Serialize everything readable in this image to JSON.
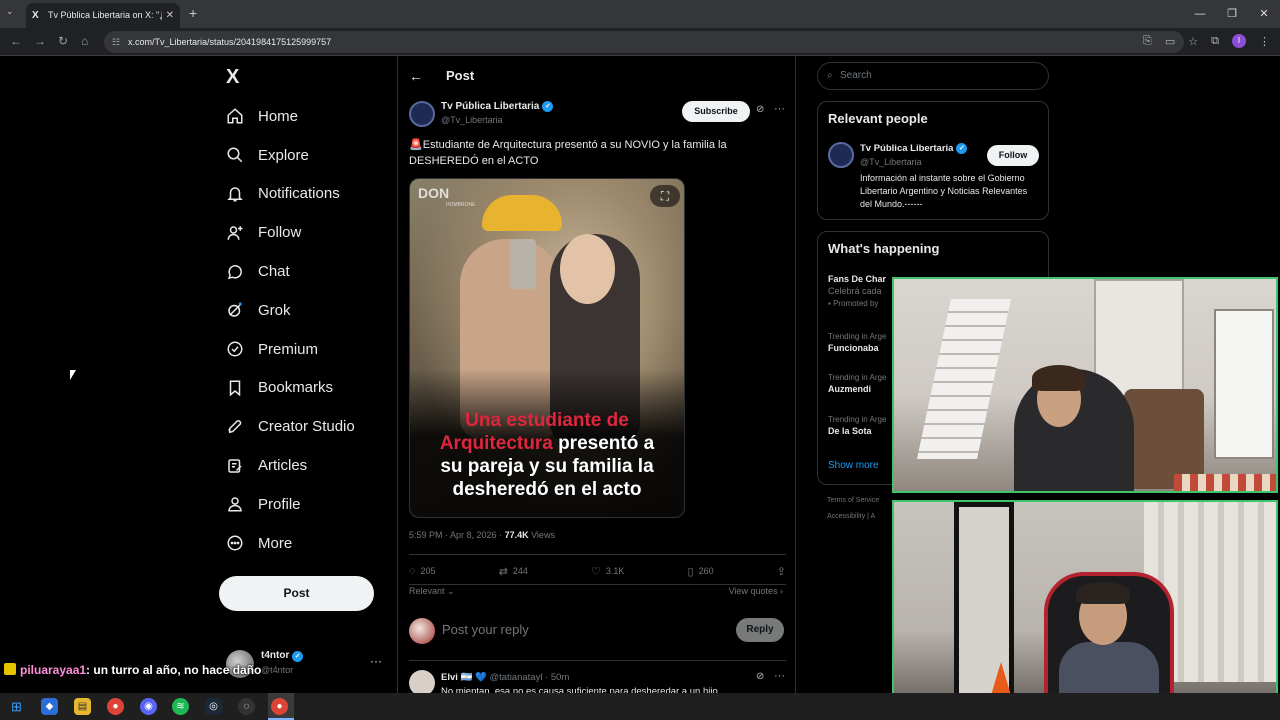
{
  "browser": {
    "tab_title": "Tv Pública Libertaria on X: \"🚨E",
    "tab_close": "✕",
    "new_tab": "+",
    "url": "x.com/Tv_Libertaria/status/2041984175125999757",
    "window_buttons": [
      "—",
      "❐",
      "✕"
    ]
  },
  "sidebar": {
    "logo": "X",
    "items": [
      {
        "label": "Home",
        "icon": "home-icon"
      },
      {
        "label": "Explore",
        "icon": "search-icon"
      },
      {
        "label": "Notifications",
        "icon": "bell-icon"
      },
      {
        "label": "Follow",
        "icon": "add-user-icon"
      },
      {
        "label": "Chat",
        "icon": "chat-bubble-icon"
      },
      {
        "label": "Grok",
        "icon": "grok-icon"
      },
      {
        "label": "Premium",
        "icon": "premium-check-icon"
      },
      {
        "label": "Bookmarks",
        "icon": "bookmark-icon"
      },
      {
        "label": "Creator Studio",
        "icon": "rocket-icon"
      },
      {
        "label": "Articles",
        "icon": "article-edit-icon"
      },
      {
        "label": "Profile",
        "icon": "person-icon"
      },
      {
        "label": "More",
        "icon": "more-circle-icon"
      }
    ],
    "post_button": "Post",
    "account": {
      "name": "t4ntor",
      "handle": "@t4ntor",
      "more": "···"
    }
  },
  "main": {
    "header_title": "Post",
    "author": {
      "name": "Tv Pública Libertaria",
      "handle": "@Tv_Libertaria"
    },
    "subscribe_label": "Subscribe",
    "post_text": "🚨Estudiante de Arquitectura presentó a su NOVIO y la familia la DESHEREDÓ en el ACTO",
    "media": {
      "brand": "DON",
      "brand_sub": "HOMBRONE",
      "caption_red_1": "Una estudiante de",
      "caption_red_2": "Arquitectura",
      "caption_white_2": " presentó a",
      "caption_white_3": "su pareja y su familia la",
      "caption_white_4": "desheredó en el acto"
    },
    "meta": {
      "time": "5:59 PM · Apr 8, 2026 · ",
      "views_count": "77.4K",
      "views_label": " Views"
    },
    "stats": {
      "replies": "205",
      "reposts": "244",
      "likes": "3.1K",
      "bookmarks": "260"
    },
    "sort_label": "Relevant ⌄",
    "view_quotes": "View quotes ›",
    "reply_placeholder": "Post your reply",
    "reply_button": "Reply",
    "comment": {
      "name": "Elvi 🇦🇷 💙",
      "handle": "@tatianatayl · 50m",
      "text": "No mientan, esa no es causa suficiente para desheredar a un hijo"
    }
  },
  "right": {
    "search_placeholder": "Search",
    "relevant_people_title": "Relevant people",
    "person": {
      "name": "Tv Pública Libertaria",
      "handle": "@Tv_Libertaria",
      "follow": "Follow",
      "bio": "Información al instante sobre el Gobierno Libertario Argentino y Noticias Relevantes del Mundo.------"
    },
    "whats_happening_title": "What's happening",
    "trends": [
      {
        "context": "",
        "title": "Fans De Char",
        "sub": "Celebrá cada",
        "promo": "Promoted by"
      },
      {
        "context": "Trending in Arge",
        "title": "Funcionaba"
      },
      {
        "context": "Trending in Arge",
        "title": "Auzmendi"
      },
      {
        "context": "Trending in Arge",
        "title": "De la Sota"
      }
    ],
    "show_more": "Show more",
    "footer_1": "Terms of Service",
    "footer_2": "Accessibility  |  A"
  },
  "overlay": {
    "chat_user": "piluarayaa1",
    "chat_message": ": un turro al año, no hace daño"
  },
  "colors": {
    "accent": "#1d9bf0",
    "cam_border": "#3fc46a",
    "caption_red": "#e0263d"
  }
}
